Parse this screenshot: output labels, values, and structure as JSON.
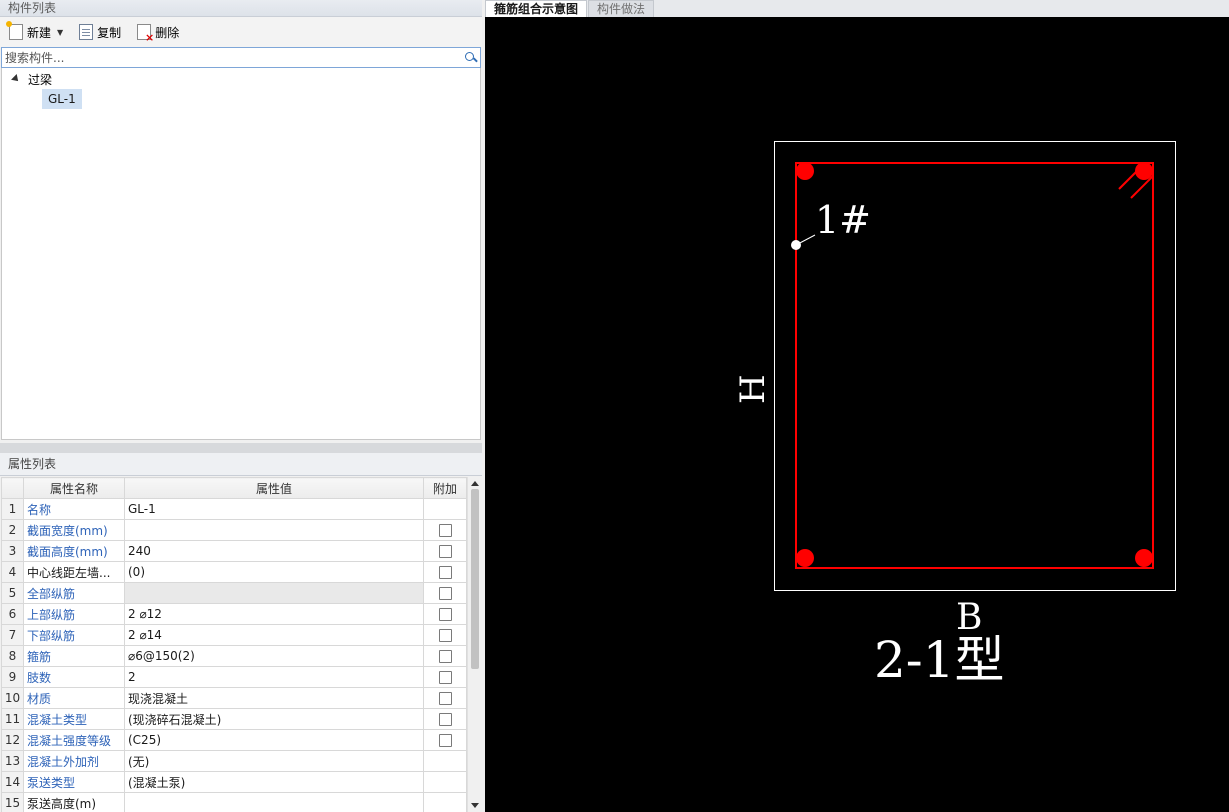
{
  "component_list": {
    "title": "构件列表",
    "toolbar": {
      "new_label": "新建",
      "copy_label": "复制",
      "delete_label": "删除"
    },
    "search": {
      "placeholder": "搜索构件..."
    },
    "tree": {
      "root_label": "过梁",
      "children": [
        "GL-1"
      ]
    }
  },
  "property_list": {
    "title": "属性列表",
    "headers": {
      "num": "",
      "name": "属性名称",
      "value": "属性值",
      "extra": "附加"
    },
    "rows": [
      {
        "num": "1",
        "name": "名称",
        "value": "GL-1",
        "checkbox": false,
        "name_color": "blue"
      },
      {
        "num": "2",
        "name": "截面宽度(mm)",
        "value": "",
        "checkbox": true,
        "name_color": "blue"
      },
      {
        "num": "3",
        "name": "截面高度(mm)",
        "value": "240",
        "checkbox": true,
        "name_color": "blue"
      },
      {
        "num": "4",
        "name": "中心线距左墙...",
        "value": "(0)",
        "checkbox": true,
        "name_color": "black"
      },
      {
        "num": "5",
        "name": "全部纵筋",
        "value": "",
        "checkbox": true,
        "name_color": "blue",
        "gray": true
      },
      {
        "num": "6",
        "name": "上部纵筋",
        "value": "2 ⌀12",
        "checkbox": true,
        "name_color": "blue"
      },
      {
        "num": "7",
        "name": "下部纵筋",
        "value": "2 ⌀14",
        "checkbox": true,
        "name_color": "blue"
      },
      {
        "num": "8",
        "name": "箍筋",
        "value": "⌀6@150(2)",
        "checkbox": true,
        "name_color": "blue"
      },
      {
        "num": "9",
        "name": "肢数",
        "value": "2",
        "checkbox": true,
        "name_color": "blue"
      },
      {
        "num": "10",
        "name": "材质",
        "value": "现浇混凝土",
        "checkbox": true,
        "name_color": "blue"
      },
      {
        "num": "11",
        "name": "混凝土类型",
        "value": "(现浇碎石混凝土)",
        "checkbox": true,
        "name_color": "blue"
      },
      {
        "num": "12",
        "name": "混凝土强度等级",
        "value": "(C25)",
        "checkbox": true,
        "name_color": "blue"
      },
      {
        "num": "13",
        "name": "混凝土外加剂",
        "value": "(无)",
        "checkbox": false,
        "name_color": "blue"
      },
      {
        "num": "14",
        "name": "泵送类型",
        "value": "(混凝土泵)",
        "checkbox": false,
        "name_color": "blue"
      },
      {
        "num": "15",
        "name": "泵送高度(m)",
        "value": "",
        "checkbox": false,
        "name_color": "black"
      }
    ]
  },
  "diagram": {
    "tabs": [
      "箍筋组合示意图",
      "构件做法"
    ],
    "active_tab": 0,
    "labels": {
      "stirrup_label": "1#",
      "height_label": "H",
      "width_label": "B",
      "type_label": "2-1型"
    },
    "colors": {
      "background": "#000000",
      "outline": "#ffffff",
      "stirrup": "#ff0000",
      "rebar": "#ff0000",
      "text": "#ffffff"
    }
  }
}
